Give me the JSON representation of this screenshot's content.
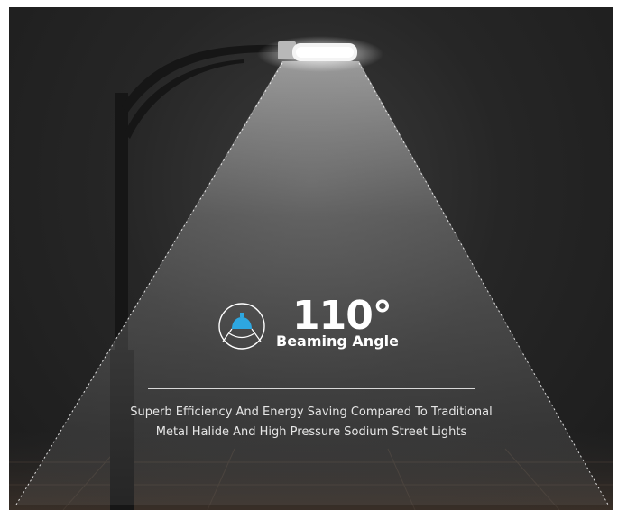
{
  "feature": {
    "value": "110°",
    "label": "Beaming Angle",
    "icon": "beam-angle-icon",
    "accent_color": "#2ea7e0"
  },
  "caption": {
    "line1": "Superb Efficiency And Energy Saving Compared To Traditional",
    "line2": "Metal Halide And High Pressure Sodium Street Lights"
  }
}
